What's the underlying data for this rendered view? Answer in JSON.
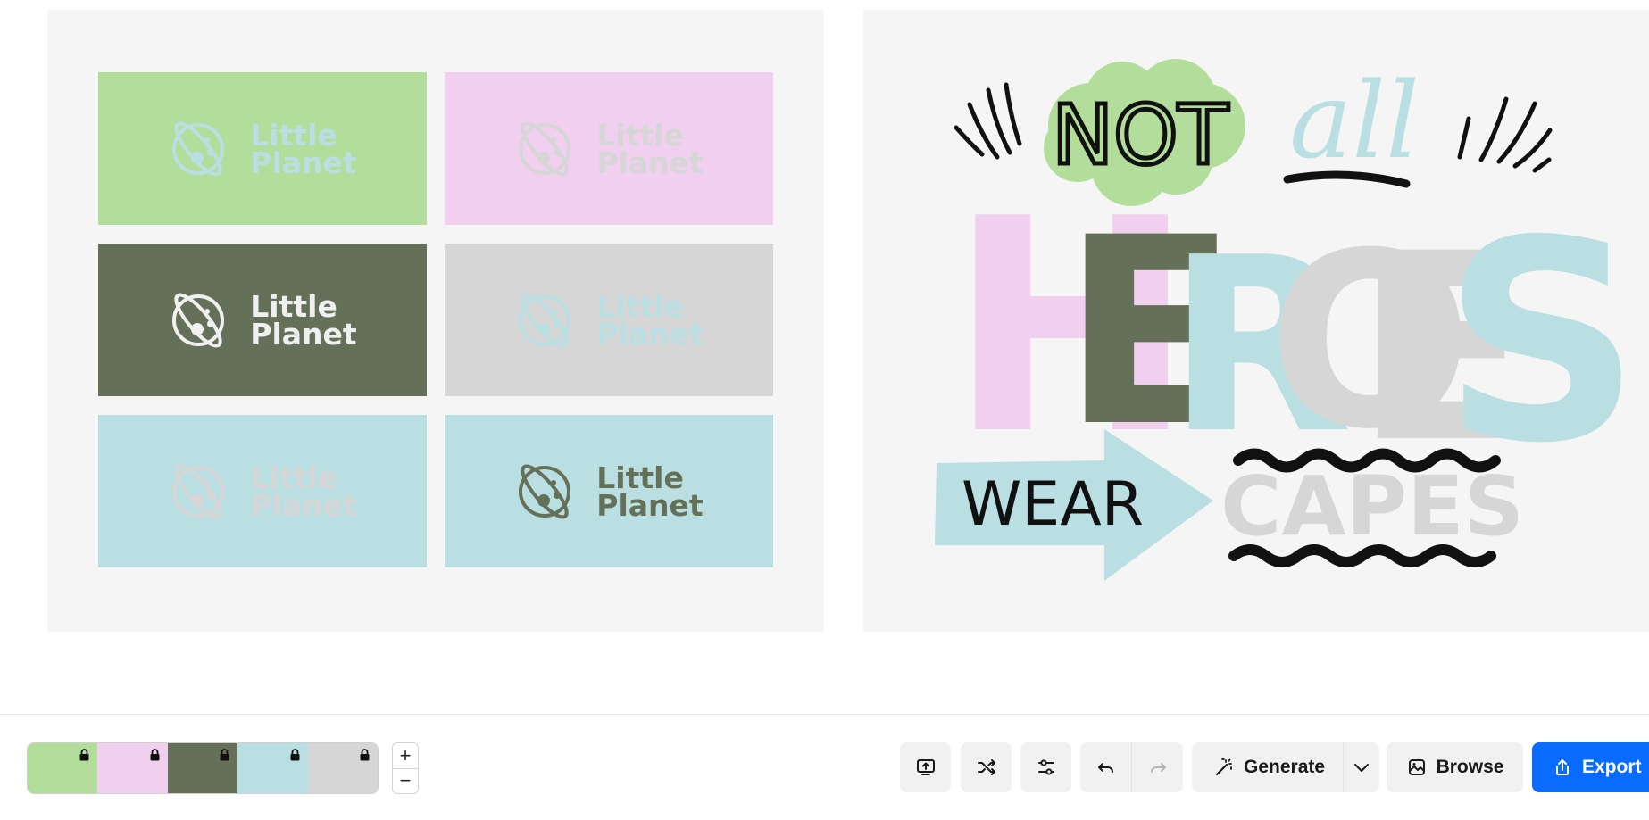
{
  "brand_colors": {
    "green": "#b2dd9b",
    "pink": "#f0d0ee",
    "olive": "#647057",
    "blue": "#badfe3",
    "gray": "#d6d6d6",
    "accent": "#0a6cff"
  },
  "logo_tiles": [
    {
      "bg": "#b2dd9b",
      "fg": "#badfe3",
      "line1": "Little",
      "line2": "Planet"
    },
    {
      "bg": "#f0d0ee",
      "fg": "#d6d6d6",
      "line1": "Little",
      "line2": "Planet"
    },
    {
      "bg": "#647057",
      "fg": "#f0f0f0",
      "line1": "Little",
      "line2": "Planet"
    },
    {
      "bg": "#d6d6d6",
      "fg": "#badfe3",
      "line1": "Little",
      "line2": "Planet"
    },
    {
      "bg": "#badfe3",
      "fg": "#d6d6d6",
      "line1": "Little",
      "line2": "Planet"
    },
    {
      "bg": "#badfe3",
      "fg": "#647057",
      "line1": "Little",
      "line2": "Planet"
    }
  ],
  "poster": {
    "word_not": "NOT",
    "word_all": "all",
    "word_heroes": [
      "H",
      "E",
      "R",
      "O",
      "E",
      "S"
    ],
    "word_wear": "WEAR",
    "word_capes": "CAPES"
  },
  "palette": {
    "swatches": [
      {
        "color": "#b2dd9b",
        "locked": true
      },
      {
        "color": "#f0d0ee",
        "locked": true
      },
      {
        "color": "#647057",
        "locked": true
      },
      {
        "color": "#badfe3",
        "locked": true
      },
      {
        "color": "#d6d6d6",
        "locked": true
      }
    ]
  },
  "zoom": {
    "plus": "+",
    "minus": "−"
  },
  "toolbar": {
    "generate_label": "Generate",
    "browse_label": "Browse",
    "export_label": "Export"
  },
  "icons": {
    "upload": "upload-image-icon",
    "shuffle": "shuffle-icon",
    "adjust": "sliders-icon",
    "undo": "undo-icon",
    "redo": "redo-icon",
    "generate": "magic-wand-icon",
    "dropdown": "chevron-down-icon",
    "browse": "gallery-icon",
    "export": "share-icon",
    "lock": "lock-icon"
  }
}
